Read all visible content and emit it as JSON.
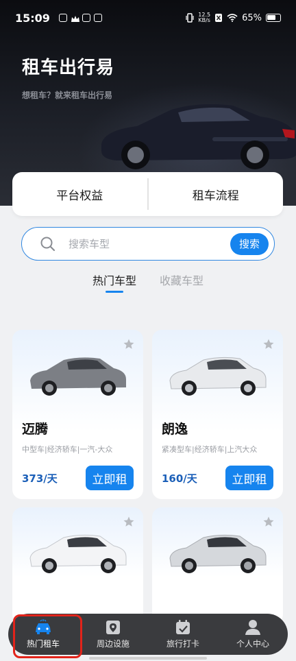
{
  "status_bar": {
    "time": "15:09",
    "net_speed_value": "12.5",
    "net_speed_unit": "KB/s",
    "battery": "65%"
  },
  "hero": {
    "title": "租车出行易",
    "subtitle": "想租车？就来租车出行易"
  },
  "benefits": {
    "left": "平台权益",
    "right": "租车流程"
  },
  "search": {
    "placeholder": "搜索车型",
    "button": "搜索"
  },
  "tabs": [
    {
      "label": "热门车型",
      "active": true
    },
    {
      "label": "收藏车型",
      "active": false
    }
  ],
  "cars": [
    {
      "name": "迈腾",
      "tags": "中型车|经济轿车|一汽-大众",
      "price": "373/天",
      "button": "立即租",
      "color": "#7c7f85"
    },
    {
      "name": "朗逸",
      "tags": "紧凑型车|经济轿车|上汽大众",
      "price": "160/天",
      "button": "立即租",
      "color": "#e8eaed"
    },
    {
      "color": "#f3f4f6"
    },
    {
      "color": "#d5d8dc"
    }
  ],
  "nav": [
    {
      "label": "热门租车",
      "icon": "car-icon",
      "active": true
    },
    {
      "label": "周边设施",
      "icon": "location-pin-icon",
      "active": false
    },
    {
      "label": "旅行打卡",
      "icon": "calendar-check-icon",
      "active": false
    },
    {
      "label": "个人中心",
      "icon": "person-icon",
      "active": false
    }
  ],
  "colors": {
    "accent": "#1684ee",
    "highlight": "#e2231a",
    "price": "#1b5fb8"
  }
}
